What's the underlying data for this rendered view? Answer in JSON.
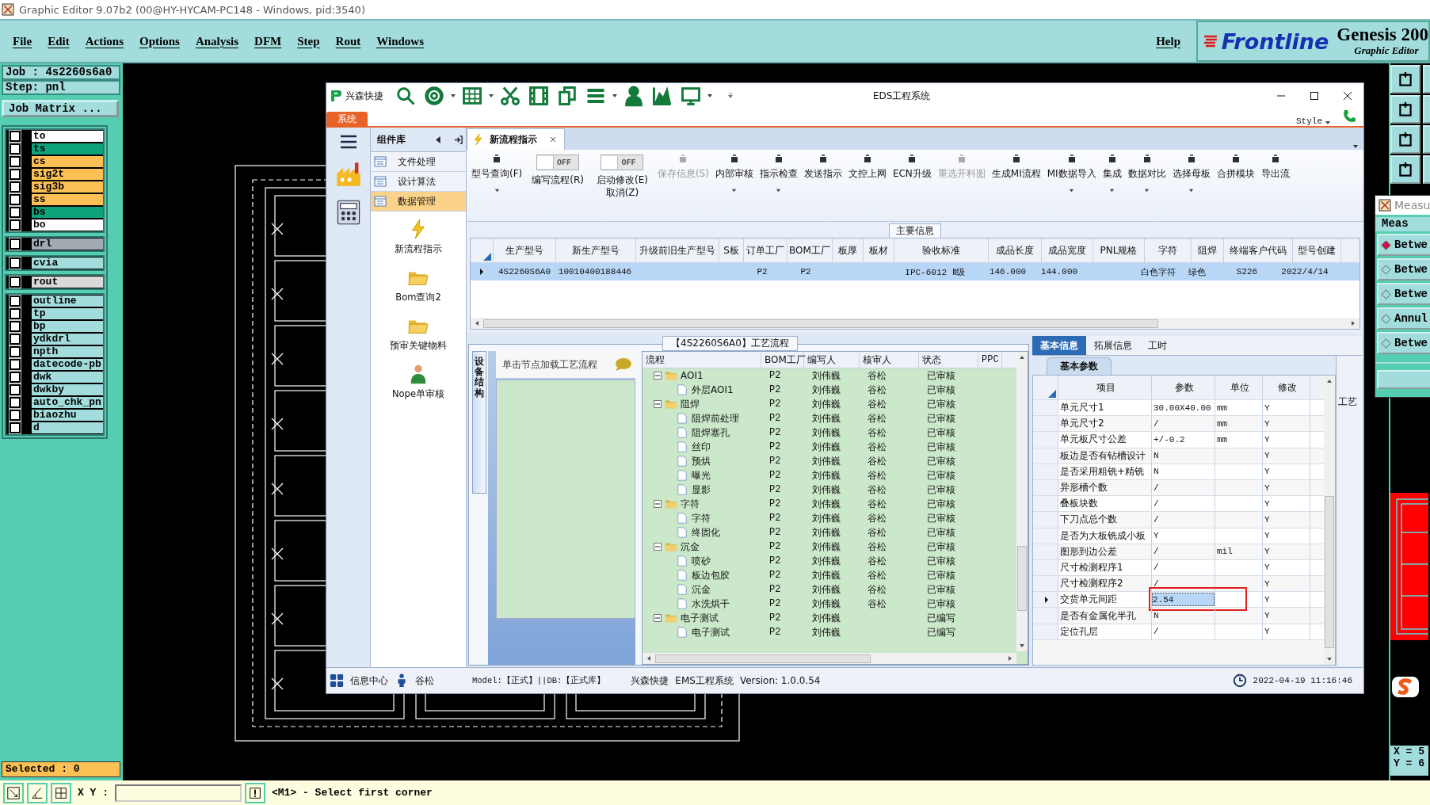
{
  "window": {
    "title": "Graphic Editor 9.07b2 (00@HY-HYCAM-PC148 - Windows, pid:3540)"
  },
  "menu": [
    "File",
    "Edit",
    "Actions",
    "Options",
    "Analysis",
    "DFM",
    "Step",
    "Rout",
    "Windows"
  ],
  "help_menu": "Help",
  "brand": {
    "logo": "Frontline",
    "product": "Genesis 200",
    "subtitle": "Graphic Editor"
  },
  "job": "Job : 4s2260s6a0",
  "step": "Step: pnl",
  "job_matrix_button": "Job Matrix ...",
  "layer_groups": [
    {
      "layers": [
        {
          "name": "to",
          "color": "#ffffff",
          "checked": false
        },
        {
          "name": "ts",
          "color": "#0fa37a",
          "checked": false
        },
        {
          "name": "cs",
          "color": "#fcc055",
          "checked": false
        },
        {
          "name": "sig2t",
          "color": "#fcc055",
          "checked": false
        },
        {
          "name": "sig3b",
          "color": "#fcc055",
          "checked": false
        },
        {
          "name": "ss",
          "color": "#fcc055",
          "checked": false
        },
        {
          "name": "bs",
          "color": "#0fa37a",
          "checked": false
        },
        {
          "name": "bo",
          "color": "#ffffff",
          "checked": false
        }
      ]
    },
    {
      "layers": [
        {
          "name": "drl",
          "color": "#a2aab2",
          "checked": false
        }
      ]
    },
    {
      "layers": [
        {
          "name": "cvia",
          "color": "#a3dcdc",
          "checked": false
        }
      ]
    },
    {
      "layers": [
        {
          "name": "rout",
          "color": "#d9d9d9",
          "checked": false
        }
      ]
    },
    {
      "layers": [
        {
          "name": "outline",
          "color": "#a3dcdc",
          "checked": false
        },
        {
          "name": "tp",
          "color": "#a3dcdc",
          "checked": false
        },
        {
          "name": "bp",
          "color": "#a3dcdc",
          "checked": false
        },
        {
          "name": "ydkdrl",
          "color": "#a3dcdc",
          "checked": false
        },
        {
          "name": "npth",
          "color": "#a3dcdc",
          "checked": false
        },
        {
          "name": "datecode-pb",
          "color": "#a3dcdc",
          "checked": false
        },
        {
          "name": "dwk",
          "color": "#a3dcdc",
          "checked": false
        },
        {
          "name": "dwkby",
          "color": "#a3dcdc",
          "checked": false
        },
        {
          "name": "auto_chk_pn",
          "color": "#a3dcdc",
          "checked": false
        },
        {
          "name": "biaozhu",
          "color": "#a3dcdc",
          "checked": false
        },
        {
          "name": "d",
          "color": "#a3dcdc",
          "checked": false
        }
      ]
    }
  ],
  "selected_count": "Selected : 0",
  "status_bar": {
    "xy_label": "X Y :",
    "message": "<M1> - Select first corner"
  },
  "measure_window": {
    "title": "Measu",
    "header": "Meas",
    "items": [
      {
        "label": "Betwe",
        "selected": true
      },
      {
        "label": "Betwe",
        "selected": false
      },
      {
        "label": "Betwe",
        "selected": false
      },
      {
        "label": "Annul",
        "selected": false
      },
      {
        "label": "Betwe",
        "selected": false
      }
    ]
  },
  "coordinates": [
    "X = 5",
    "Y = 6"
  ],
  "eds": {
    "app_name": "兴森快捷",
    "title": "EDS工程系统",
    "menu_tab": "系统",
    "style_label": "Style",
    "side_panel": {
      "title": "组件库",
      "categories": [
        {
          "label": "文件处理",
          "selected": false
        },
        {
          "label": "设计算法",
          "selected": false
        },
        {
          "label": "数据管理",
          "selected": true
        }
      ],
      "modules": [
        "新流程指示",
        "Bom查询2",
        "预审关键物料",
        "Nope单审核"
      ]
    },
    "doc_tab": {
      "label": "新流程指示",
      "selected": true
    },
    "ribbon": [
      {
        "kind": "button",
        "label": "型号查询(F)",
        "dropdown": true,
        "disabled": false
      },
      {
        "kind": "toggle",
        "switch_label": "OFF",
        "on": false,
        "label": "编写流程(R)"
      },
      {
        "kind": "toggle",
        "switch_label": "OFF",
        "on": false,
        "label": "启动修改(E)\n取消(Z)"
      },
      {
        "kind": "button",
        "label": "保存信息(S)",
        "dropdown": false,
        "disabled": true
      },
      {
        "kind": "button",
        "label": "内部审核",
        "dropdown": true,
        "disabled": false
      },
      {
        "kind": "button",
        "label": "指示检查",
        "dropdown": true,
        "disabled": false
      },
      {
        "kind": "button",
        "label": "发送指示",
        "dropdown": false,
        "disabled": false
      },
      {
        "kind": "button",
        "label": "文控上网",
        "dropdown": false,
        "disabled": false
      },
      {
        "kind": "button",
        "label": "ECN升级",
        "dropdown": false,
        "disabled": false
      },
      {
        "kind": "button",
        "label": "重选开料图",
        "dropdown": false,
        "disabled": true
      },
      {
        "kind": "button",
        "label": "生成MI流程",
        "dropdown": false,
        "disabled": false
      },
      {
        "kind": "button",
        "label": "MI数据导入",
        "dropdown": true,
        "disabled": false
      },
      {
        "kind": "button",
        "label": "集成",
        "dropdown": true,
        "disabled": false
      },
      {
        "kind": "button",
        "label": "数据对比",
        "dropdown": true,
        "disabled": false
      },
      {
        "kind": "button",
        "label": "选择母板",
        "dropdown": true,
        "disabled": false
      },
      {
        "kind": "button",
        "label": "合拼模块",
        "dropdown": false,
        "disabled": false
      },
      {
        "kind": "button",
        "label": "导出流",
        "dropdown": false,
        "disabled": false
      }
    ],
    "main_info": {
      "title": "主要信息",
      "columns": [
        "生产型号",
        "新生产型号",
        "升级前旧生产型号",
        "S板",
        "订单工厂",
        "BOM工厂",
        "板厚",
        "板材",
        "验收标准",
        "成品长度",
        "成品宽度",
        "PNL规格",
        "字符",
        "阻焊",
        "终端客户代码",
        "型号创建"
      ],
      "rows": [
        {
          "selected": true,
          "cells": [
            "4S2260S6A0",
            "10010400188446",
            null,
            null,
            "P2",
            "P2",
            null,
            null,
            "IPC-6012 Ⅱ级",
            "146.000",
            "144.000",
            null,
            "白色字符",
            "绿色",
            "S226",
            "2022/4/14"
          ]
        }
      ]
    },
    "flow_panel": {
      "title": "【4S2260S6A0】工艺流程",
      "side_tab": "设备结构",
      "hint": "单击节点加载工艺流程",
      "columns": [
        "流程",
        "BOM工厂",
        "编写人",
        "核审人",
        "状态",
        "PPC"
      ],
      "tree": [
        {
          "label": "AOI1",
          "expanded": true,
          "bom": "P2",
          "writer": "刘伟巍",
          "reviewer": "谷松",
          "status": "已审核",
          "children": [
            {
              "label": "外层AOI1",
              "bom": "P2",
              "writer": "刘伟巍",
              "reviewer": "谷松",
              "status": "已审核"
            }
          ]
        },
        {
          "label": "阻焊",
          "expanded": true,
          "bom": "P2",
          "writer": "刘伟巍",
          "reviewer": "谷松",
          "status": "已审核",
          "children": [
            {
              "label": "阻焊前处理",
              "bom": "P2",
              "writer": "刘伟巍",
              "reviewer": "谷松",
              "status": "已审核"
            },
            {
              "label": "阻焊塞孔",
              "bom": "P2",
              "writer": "刘伟巍",
              "reviewer": "谷松",
              "status": "已审核"
            },
            {
              "label": "丝印",
              "bom": "P2",
              "writer": "刘伟巍",
              "reviewer": "谷松",
              "status": "已审核"
            },
            {
              "label": "预烘",
              "bom": "P2",
              "writer": "刘伟巍",
              "reviewer": "谷松",
              "status": "已审核"
            },
            {
              "label": "曝光",
              "bom": "P2",
              "writer": "刘伟巍",
              "reviewer": "谷松",
              "status": "已审核"
            },
            {
              "label": "显影",
              "bom": "P2",
              "writer": "刘伟巍",
              "reviewer": "谷松",
              "status": "已审核"
            }
          ]
        },
        {
          "label": "字符",
          "expanded": true,
          "bom": "P2",
          "writer": "刘伟巍",
          "reviewer": "谷松",
          "status": "已审核",
          "children": [
            {
              "label": "字符",
              "bom": "P2",
              "writer": "刘伟巍",
              "reviewer": "谷松",
              "status": "已审核"
            },
            {
              "label": "终固化",
              "bom": "P2",
              "writer": "刘伟巍",
              "reviewer": "谷松",
              "status": "已审核"
            }
          ]
        },
        {
          "label": "沉金",
          "expanded": true,
          "bom": "P2",
          "writer": "刘伟巍",
          "reviewer": "谷松",
          "status": "已审核",
          "children": [
            {
              "label": "喷砂",
              "bom": "P2",
              "writer": "刘伟巍",
              "reviewer": "谷松",
              "status": "已审核"
            },
            {
              "label": "板边包胶",
              "bom": "P2",
              "writer": "刘伟巍",
              "reviewer": "谷松",
              "status": "已审核"
            },
            {
              "label": "沉金",
              "bom": "P2",
              "writer": "刘伟巍",
              "reviewer": "谷松",
              "status": "已审核"
            },
            {
              "label": "水洗烘干",
              "bom": "P2",
              "writer": "刘伟巍",
              "reviewer": "谷松",
              "status": "已审核"
            }
          ]
        },
        {
          "label": "电子测试",
          "expanded": true,
          "bom": "P2",
          "writer": "刘伟巍",
          "status": "已编写",
          "children": [
            {
              "label": "电子测试",
              "bom": "P2",
              "writer": "刘伟巍",
              "status": "已编写"
            }
          ]
        }
      ]
    },
    "params_panel": {
      "tabs": [
        {
          "label": "基本信息",
          "selected": true
        },
        {
          "label": "拓展信息",
          "selected": false
        },
        {
          "label": "工时",
          "selected": false
        }
      ],
      "subtab": "基本参数",
      "side_label": "工艺",
      "columns": [
        "项目",
        "参数",
        "单位",
        "修改"
      ],
      "rows": [
        {
          "item": "单元尺寸1",
          "value": "30.00X40.00",
          "unit": "mm",
          "modify": "Y",
          "selected": false,
          "highlighted": false
        },
        {
          "item": "单元尺寸2",
          "value": "/",
          "unit": "mm",
          "modify": "Y",
          "selected": false,
          "highlighted": false
        },
        {
          "item": "单元板尺寸公差",
          "value": "+/-0.2",
          "unit": "mm",
          "modify": "Y",
          "selected": false,
          "highlighted": false
        },
        {
          "item": "板边是否有钻槽设计",
          "value": "N",
          "modify": "Y",
          "selected": false,
          "highlighted": false
        },
        {
          "item": "是否采用粗铣+精铣",
          "value": "N",
          "modify": "Y",
          "selected": false,
          "highlighted": false
        },
        {
          "item": "异形槽个数",
          "value": "/",
          "modify": "Y",
          "selected": false,
          "highlighted": false
        },
        {
          "item": "叠板块数",
          "value": "/",
          "modify": "Y",
          "selected": false,
          "highlighted": false
        },
        {
          "item": "下刀点总个数",
          "value": "/",
          "modify": "Y",
          "selected": false,
          "highlighted": false
        },
        {
          "item": "是否为大板铣成小板",
          "value": "Y",
          "modify": "Y",
          "selected": false,
          "highlighted": false
        },
        {
          "item": "图形到边公差",
          "value": "/",
          "unit": "mil",
          "modify": "Y",
          "selected": false,
          "highlighted": false
        },
        {
          "item": "尺寸检测程序1",
          "value": "/",
          "modify": "Y",
          "selected": false,
          "highlighted": false
        },
        {
          "item": "尺寸检测程序2",
          "value": "/",
          "modify": "Y",
          "selected": false,
          "highlighted": false
        },
        {
          "item": "交货单元间距",
          "value": "2.54",
          "modify": "Y",
          "selected": true,
          "highlighted": true
        },
        {
          "item": "是否有金属化半孔",
          "value": "N",
          "modify": "Y",
          "selected": false,
          "highlighted": false
        },
        {
          "item": "定位孔层",
          "value": "/",
          "modify": "Y",
          "selected": false,
          "highlighted": false
        }
      ]
    },
    "status": {
      "info_center": "信息中心",
      "user": "谷松",
      "model": "Model:【正式】||DB:【正式库】",
      "company": "兴森快捷",
      "system": "EMS工程系统",
      "version": "Version: 1.0.0.54",
      "datetime": "2022-04-19 11:16:46"
    }
  }
}
